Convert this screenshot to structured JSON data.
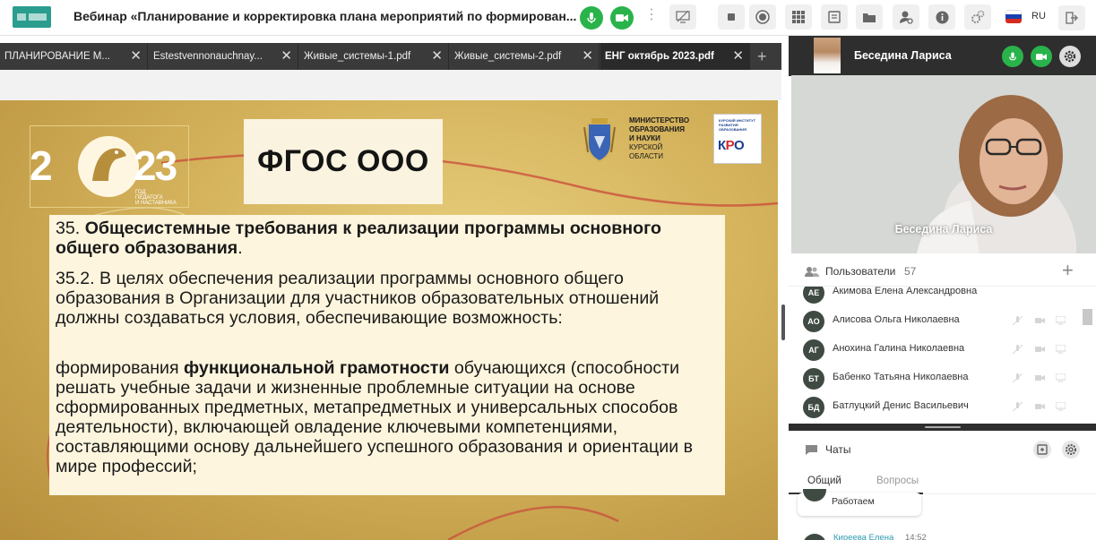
{
  "app": {
    "title": "Вебинар «Планирование и корректировка плана мероприятий по формирован...",
    "lang": "RU"
  },
  "tabs": [
    {
      "label": "ПЛАНИРОВАНИЕ М...",
      "active": false
    },
    {
      "label": "Estestvennonauchnay...",
      "active": false
    },
    {
      "label": "Живые_системы-1.pdf",
      "active": false
    },
    {
      "label": "Живые_системы-2.pdf",
      "active": false
    },
    {
      "label": "ЕНГ октябрь 2023.pdf",
      "active": true
    }
  ],
  "slide": {
    "logo_year": "2023",
    "logo_caption_1": "ГОД",
    "logo_caption_2": "ПЕДАГОГА",
    "logo_caption_3": "И НАСТАВНИКА",
    "title": "ФГОС ООО",
    "ministry_line1": "МИНИСТЕРСТВО",
    "ministry_line2": "ОБРАЗОВАНИЯ",
    "ministry_line3": "И НАУКИ",
    "ministry_line4": "КУРСКОЙ",
    "ministry_line5": "ОБЛАСТИ",
    "kiro_small": "КУРСКИЙ ИНСТИТУТ РАЗВИТИЯ ОБРАЗОВАНИЯ",
    "kiro_label_a": "К",
    "kiro_label_b": "Р",
    "kiro_label_c": "О",
    "p1_num": "35. ",
    "p1_bold": "Общесистемные требования к реализации программы основного общего образования",
    "p1_end": ".",
    "p2": "35.2. В целях обеспечения реализации программы основного общего образования в Организации для участников образовательных отношений должны создаваться условия, обеспечивающие возможность:",
    "p3_start": "формирования ",
    "p3_bold": "функциональной грамотности",
    "p3_end": " обучающихся (способности решать учебные задачи и жизненные проблемные ситуации на основе сформированных предметных, метапредметных и универсальных способов деятельности), включающей овладение ключевыми компетенциями, составляющими основу дальнейшего успешного образования и ориентации в мире профессий;"
  },
  "speaker": {
    "name": "Беседина Лариса",
    "video_name": "Беседина Лариса"
  },
  "users": {
    "label": "Пользователи",
    "count": "57",
    "list": [
      {
        "initials": "АЕ",
        "name": "Акимова Елена Александровна"
      },
      {
        "initials": "АО",
        "name": "Алисова Ольга Николаевна"
      },
      {
        "initials": "АГ",
        "name": "Анохина Галина Николаевна"
      },
      {
        "initials": "БТ",
        "name": "Бабенко Татьяна Николаевна"
      },
      {
        "initials": "БД",
        "name": "Батлуцкий Денис Васильевич"
      }
    ]
  },
  "chats": {
    "label": "Чаты",
    "tab_general": "Общий",
    "tab_questions": "Вопросы",
    "message1": "Работаем",
    "message2_author": "Киреева Елена",
    "message2_time": "14:52"
  },
  "colors": {
    "accent_green": "#29b34a",
    "tab_bar": "#3a3a3a",
    "slide_gold": "#d4b25b",
    "text_box": "#fdf5dd"
  }
}
